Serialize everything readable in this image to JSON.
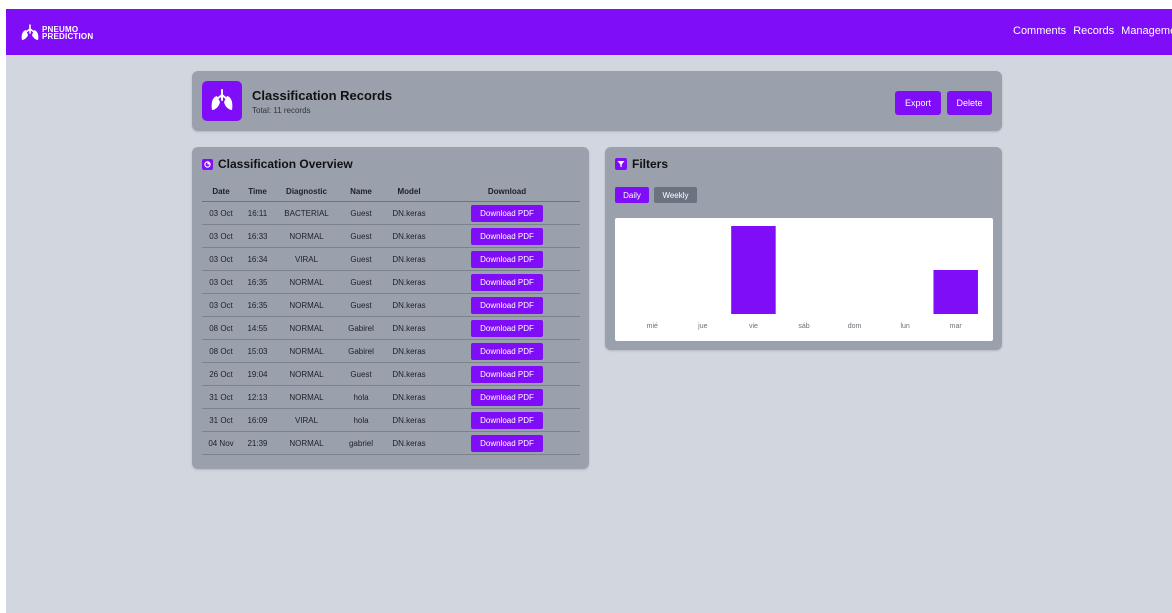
{
  "brand": {
    "line1": "PNEUMO",
    "line2": "PREDICTION",
    "logo_icon": "lungs-icon"
  },
  "nav": {
    "items": [
      "Comments",
      "Records",
      "Managemen"
    ]
  },
  "header": {
    "title": "Classification Records",
    "subtitle": "Total: 11 records",
    "icon": "lungs-icon",
    "export_label": "Export",
    "delete_label": "Delete"
  },
  "overview": {
    "title": "Classification Overview",
    "icon": "chart-icon",
    "columns": [
      "Date",
      "Time",
      "Diagnostic",
      "Name",
      "Model",
      "Download"
    ],
    "rows": [
      {
        "date": "03 Oct",
        "time": "16:11",
        "diagnostic": "BACTERIAL",
        "name": "Guest",
        "model": "DN.keras",
        "download": "Download PDF"
      },
      {
        "date": "03 Oct",
        "time": "16:33",
        "diagnostic": "NORMAL",
        "name": "Guest",
        "model": "DN.keras",
        "download": "Download PDF"
      },
      {
        "date": "03 Oct",
        "time": "16:34",
        "diagnostic": "VIRAL",
        "name": "Guest",
        "model": "DN.keras",
        "download": "Download PDF"
      },
      {
        "date": "03 Oct",
        "time": "16:35",
        "diagnostic": "NORMAL",
        "name": "Guest",
        "model": "DN.keras",
        "download": "Download PDF"
      },
      {
        "date": "03 Oct",
        "time": "16:35",
        "diagnostic": "NORMAL",
        "name": "Guest",
        "model": "DN.keras",
        "download": "Download PDF"
      },
      {
        "date": "08 Oct",
        "time": "14:55",
        "diagnostic": "NORMAL",
        "name": "Gabirel",
        "model": "DN.keras",
        "download": "Download PDF"
      },
      {
        "date": "08 Oct",
        "time": "15:03",
        "diagnostic": "NORMAL",
        "name": "Gabirel",
        "model": "DN.keras",
        "download": "Download PDF"
      },
      {
        "date": "26 Oct",
        "time": "19:04",
        "diagnostic": "NORMAL",
        "name": "Guest",
        "model": "DN.keras",
        "download": "Download PDF"
      },
      {
        "date": "31 Oct",
        "time": "12:13",
        "diagnostic": "NORMAL",
        "name": "hola",
        "model": "DN.keras",
        "download": "Download PDF"
      },
      {
        "date": "31 Oct",
        "time": "16:09",
        "diagnostic": "VIRAL",
        "name": "hola",
        "model": "DN.keras",
        "download": "Download PDF"
      },
      {
        "date": "04 Nov",
        "time": "21:39",
        "diagnostic": "NORMAL",
        "name": "gabriel",
        "model": "DN.keras",
        "download": "Download PDF"
      }
    ]
  },
  "filters": {
    "title": "Filters",
    "icon": "filter-icon",
    "daily_label": "Daily",
    "weekly_label": "Weekly",
    "selected": "Daily"
  },
  "colors": {
    "accent": "#7f0df7",
    "background": "#d2d6de",
    "card": "#9aa1ad",
    "inactive": "#6b7280"
  },
  "chart_data": {
    "type": "bar",
    "categories": [
      "mié",
      "jue",
      "vie",
      "sáb",
      "dom",
      "lun",
      "mar"
    ],
    "values": [
      0,
      0,
      2,
      0,
      0,
      0,
      1
    ],
    "ylim": [
      0,
      2
    ],
    "title": "",
    "xlabel": "",
    "ylabel": "",
    "grid": false,
    "legend": "none"
  }
}
